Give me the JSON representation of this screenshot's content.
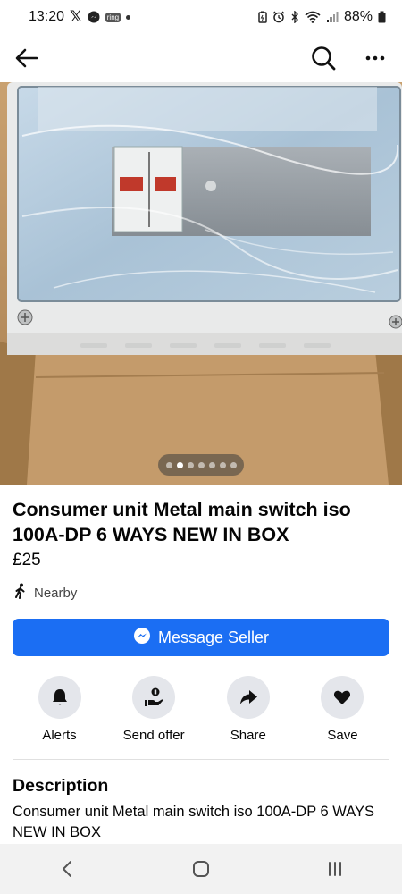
{
  "status": {
    "time": "13:20",
    "ring_label": "ring",
    "battery": "88%",
    "icons": [
      "x-icon",
      "messenger-icon",
      "ring-icon",
      "dot-icon",
      "battery-saver-icon",
      "alarm-icon",
      "bluetooth-icon",
      "wifi-icon",
      "signal-icon",
      "battery-icon"
    ]
  },
  "header": {
    "back_icon": "arrow-left-icon",
    "search_icon": "search-icon",
    "more_icon": "more-horizontal-icon"
  },
  "photo": {
    "subject": "consumer-unit-photo",
    "dots_total": 7,
    "dots_active_index": 1
  },
  "listing": {
    "title": "Consumer unit  Metal main switch iso 100A-DP   6 WAYS  NEW IN BOX",
    "price": "£25",
    "location": "Nearby"
  },
  "message_button": {
    "label": "Message Seller",
    "color": "#1b6ef3"
  },
  "actions": [
    {
      "label": "Alerts",
      "icon": "bell-icon"
    },
    {
      "label": "Send offer",
      "icon": "offer-hand-icon"
    },
    {
      "label": "Share",
      "icon": "share-arrow-icon"
    },
    {
      "label": "Save",
      "icon": "heart-icon"
    }
  ],
  "description": {
    "heading": "Description",
    "body": "Consumer unit  Metal main switch iso 100A-DP   6 WAYS  NEW IN BOX"
  },
  "nav": {
    "back_icon": "nav-back-icon",
    "home_icon": "nav-home-icon",
    "recents_icon": "nav-recents-icon"
  }
}
